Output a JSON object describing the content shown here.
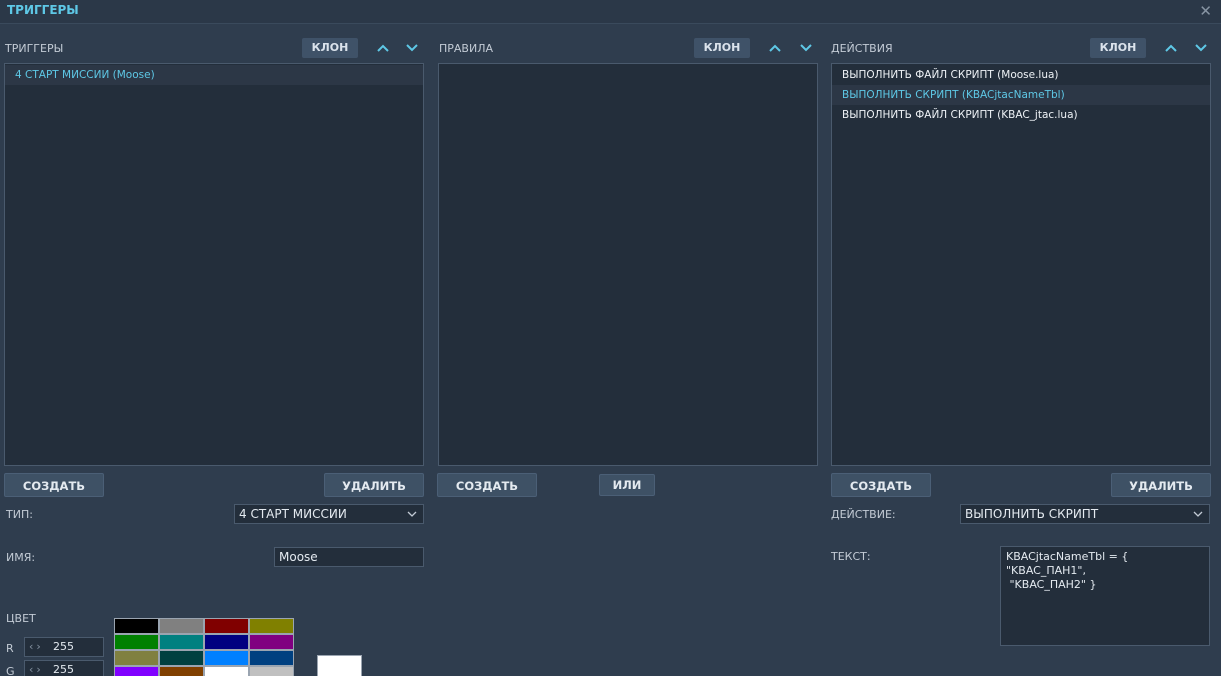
{
  "window": {
    "title": "ТРИГГЕРЫ",
    "close_icon": "close-icon"
  },
  "triggers": {
    "header": "ТРИГГЕРЫ",
    "clone_label": "КЛОН",
    "items": [
      {
        "label": "4 СТАРТ МИССИИ (Moose)"
      }
    ],
    "create_label": "СОЗДАТЬ",
    "delete_label": "УДАЛИТЬ"
  },
  "rules": {
    "header": "ПРАВИЛА",
    "clone_label": "КЛОН",
    "items": [],
    "create_label": "СОЗДАТЬ",
    "or_label": "ИЛИ"
  },
  "actions": {
    "header": "ДЕЙСТВИЯ",
    "clone_label": "КЛОН",
    "items": [
      {
        "label": "ВЫПОЛНИТЬ ФАЙЛ СКРИПТ (Moose.lua)"
      },
      {
        "label": "ВЫПОЛНИТЬ СКРИПТ (KBACjtacNameTbl)"
      },
      {
        "label": "ВЫПОЛНИТЬ ФАЙЛ СКРИПТ (KBAC_jtac.lua)"
      }
    ],
    "create_label": "СОЗДАТЬ",
    "delete_label": "УДАЛИТЬ"
  },
  "trigger_props": {
    "type_label": "ТИП:",
    "type_value": "4 СТАРТ МИССИИ",
    "name_label": "ИМЯ:",
    "name_value": "Moose",
    "color_label": "ЦВЕТ",
    "r_label": "R",
    "r_value": "255",
    "g_label": "G",
    "g_value": "255"
  },
  "action_props": {
    "action_label": "ДЕЙСТВИЕ:",
    "action_value": "ВЫПОЛНИТЬ СКРИПТ",
    "text_label": "ТЕКСТ:",
    "text_value": "KBACjtacNameTbl = { \"KBAC_ПАН1\",\n \"KBAC_ПАН2\" }"
  },
  "palette": [
    "#000000",
    "#808080",
    "#800000",
    "#808000",
    "#008000",
    "#008080",
    "#000080",
    "#800080",
    "#808040",
    "#004040",
    "#0080ff",
    "#004080",
    "#8000ff",
    "#804000",
    "#ffffff",
    "#c0c0c0"
  ],
  "colors": {
    "accent": "#5ec8e6",
    "background": "#2f3d4e",
    "list_bg": "#232e3b"
  }
}
